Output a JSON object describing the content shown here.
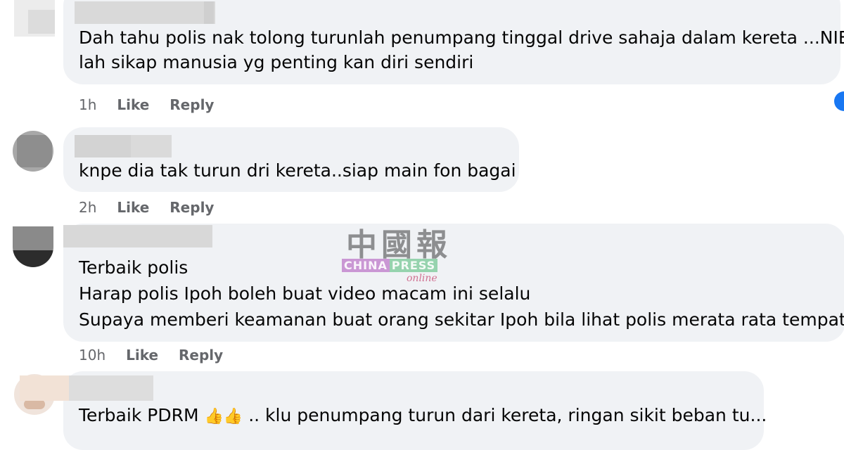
{
  "comments": [
    {
      "lines": [
        "Dah tahu polis nak tolong turunlah penumpang tinggal drive sahaja dalam kereta ...NIE",
        "lah sikap manusia yg penting kan diri sendiri"
      ],
      "time": "1h",
      "like": "Like",
      "reply": "Reply"
    },
    {
      "lines": [
        "knpe dia tak turun dri kereta..siap main fon bagai"
      ],
      "time": "2h",
      "like": "Like",
      "reply": "Reply"
    },
    {
      "lines": [
        "Terbaik polis",
        "Harap polis Ipoh boleh buat video macam ini selalu",
        "Supaya memberi keamanan buat orang sekitar Ipoh bila lihat polis merata rata tempat..."
      ],
      "time": "10h",
      "like": "Like",
      "reply": "Reply"
    },
    {
      "lines": [
        "Terbaik PDRM"
      ],
      "emoji": "👍👍",
      "tail": ".. klu penumpang turun dari kereta, ringan sikit beban tu..."
    }
  ],
  "watermark": {
    "cjk": "中國報",
    "en_part1": "CHINA",
    "en_part2": "PRESS",
    "sub": "online"
  },
  "colors": {
    "bubble": "#f0f2f5",
    "meta": "#65676b",
    "reaction_icon": "#1877f2"
  }
}
